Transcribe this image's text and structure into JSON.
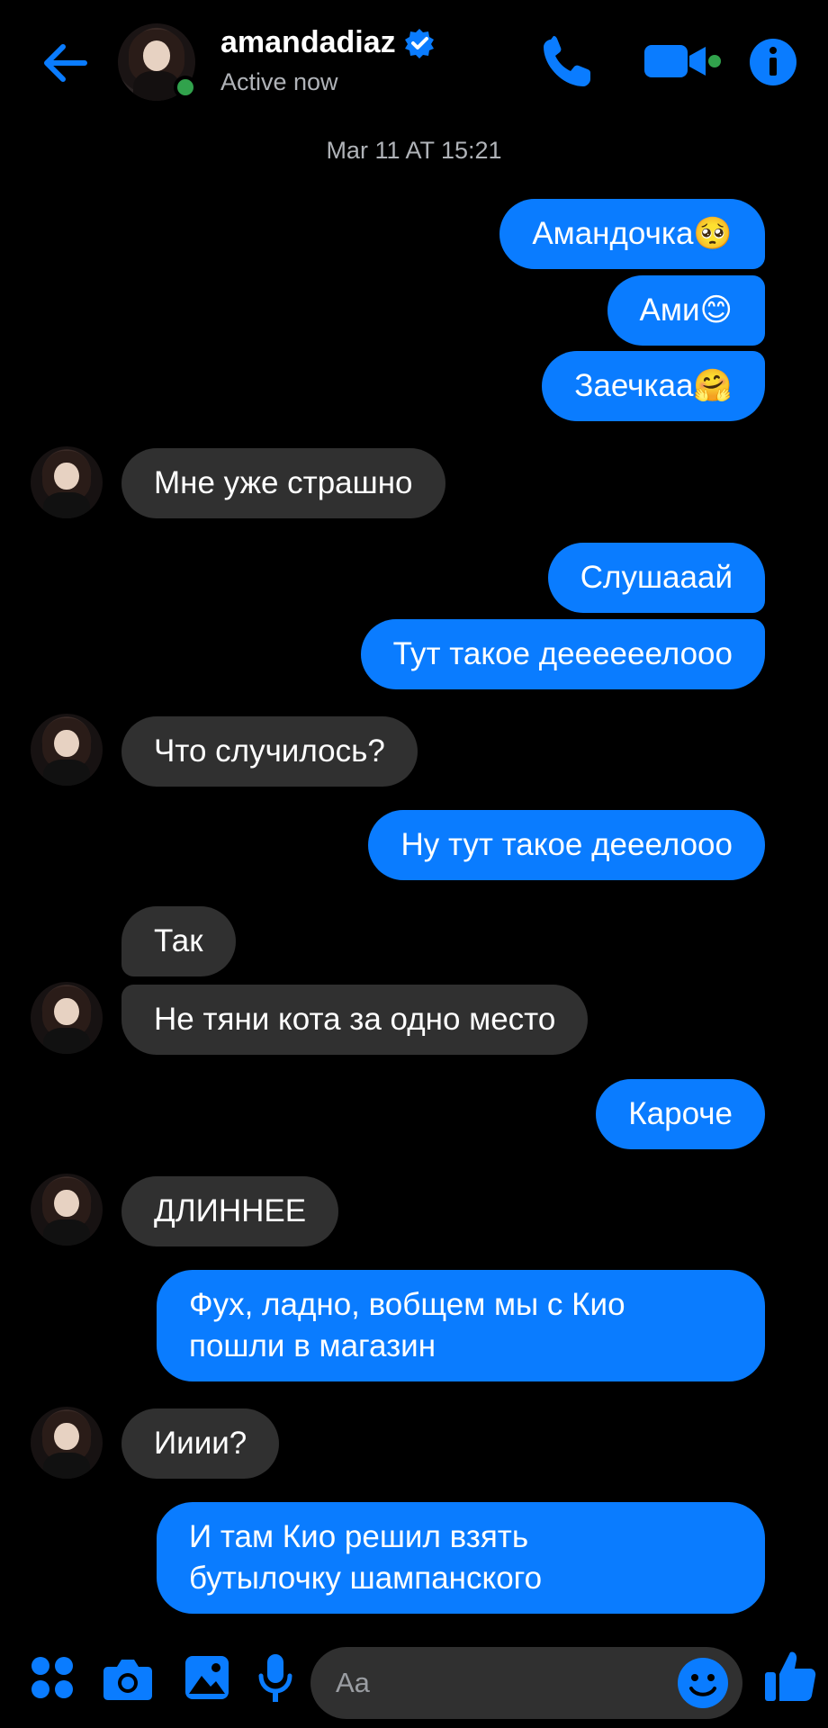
{
  "header": {
    "name": "amandadiaz",
    "status": "Active now"
  },
  "timestamp": "Mar 11 AT 15:21",
  "messages": [
    {
      "dir": "out",
      "text": "Амандочка🥺"
    },
    {
      "dir": "out",
      "text": "Ами😊"
    },
    {
      "dir": "out",
      "text": "Заечкаа🤗"
    },
    {
      "dir": "in",
      "text": "Мне уже страшно"
    },
    {
      "dir": "out",
      "text": "Слушааай"
    },
    {
      "dir": "out",
      "text": "Тут такое деееееелооо"
    },
    {
      "dir": "in",
      "text": "Что случилось?"
    },
    {
      "dir": "out",
      "text": "Ну тут такое дееелооо"
    },
    {
      "dir": "in",
      "text": "Так"
    },
    {
      "dir": "in",
      "text": "Не тяни кота за одно место"
    },
    {
      "dir": "out",
      "text": "Кароче"
    },
    {
      "dir": "in",
      "text": "ДЛИННЕЕ"
    },
    {
      "dir": "out",
      "line1": "Фух, ладно, вобщем мы с Кио",
      "line2": "пошли в магазин"
    },
    {
      "dir": "in",
      "text": "Ииии?"
    },
    {
      "dir": "out",
      "line1": "И там Кио решил взять",
      "line2": "бутылочку шампанского"
    }
  ],
  "composer": {
    "placeholder": "Aa"
  },
  "colors": {
    "accent": "#0a7cff",
    "incoming": "#303030",
    "online": "#31a24c"
  },
  "icons": [
    "back-arrow-icon",
    "verified-badge-icon",
    "phone-icon",
    "video-camera-icon",
    "info-icon",
    "apps-icon",
    "camera-icon",
    "gallery-icon",
    "microphone-icon",
    "emoji-icon",
    "thumbs-up-icon"
  ]
}
